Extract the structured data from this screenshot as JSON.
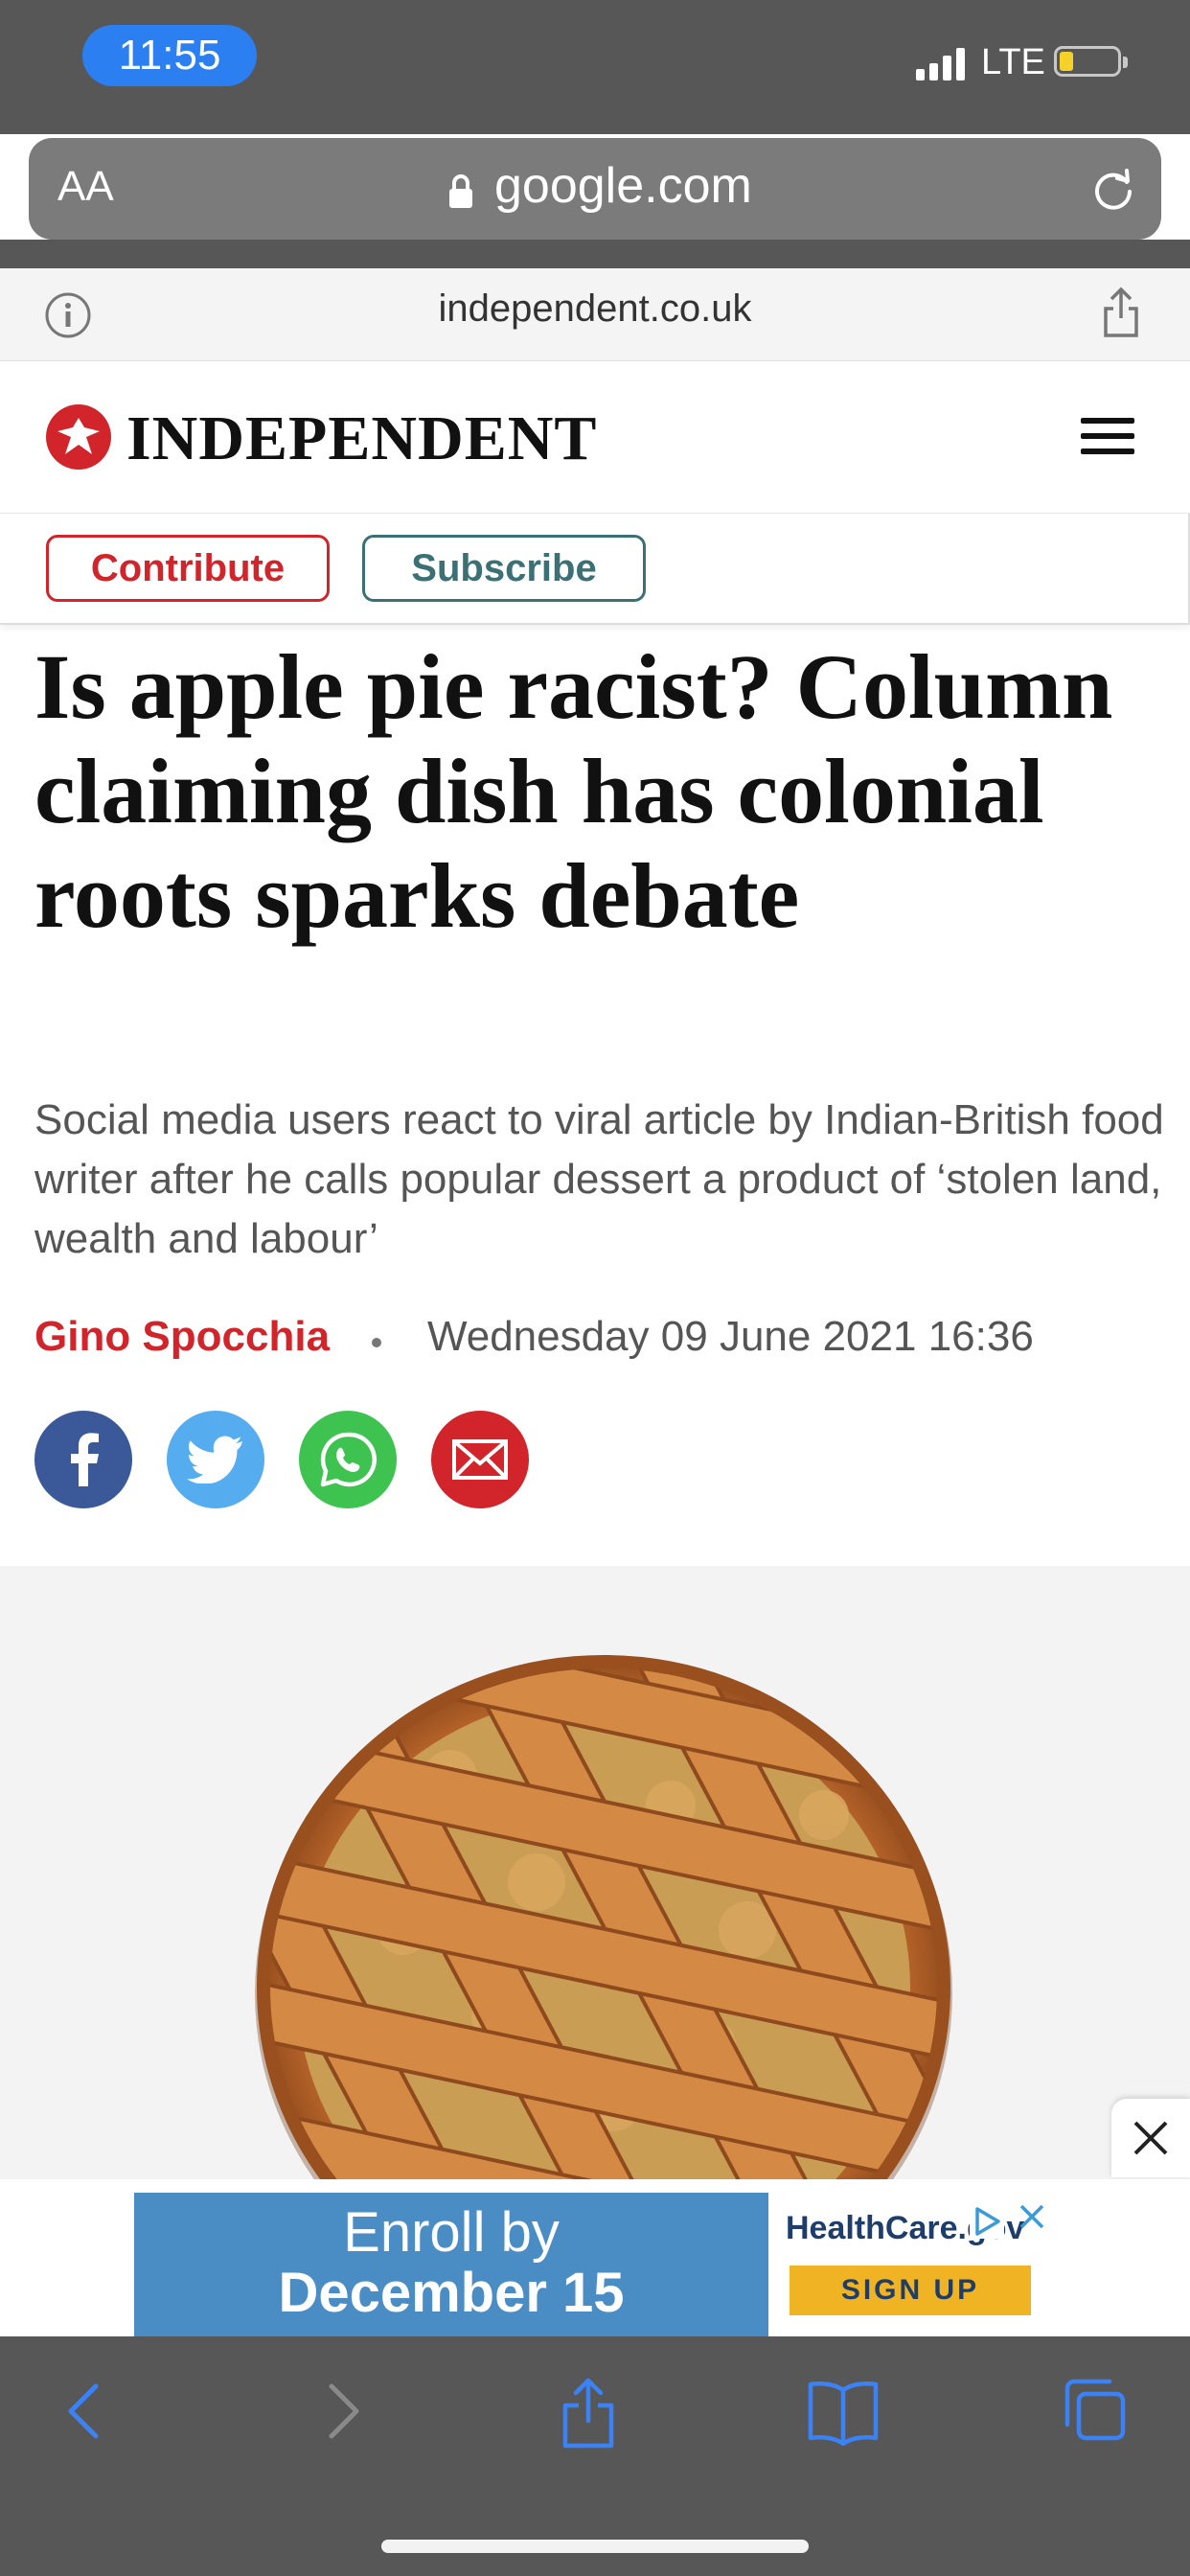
{
  "status_bar": {
    "time": "11:55",
    "network": "LTE",
    "battery_level": 0.2
  },
  "browser": {
    "text_size_label": "AA",
    "url": "google.com",
    "site_domain": "independent.co.uk"
  },
  "site": {
    "logo_text": "INDEPENDENT",
    "contribute_label": "Contribute",
    "subscribe_label": "Subscribe",
    "brand_color": "#d1242b"
  },
  "article": {
    "headline": "Is apple pie racist? Column claiming dish has colonial roots sparks debate",
    "standfirst": "Social media users react to viral article by Indian-British food writer after he calls popular dessert a product of ‘stolen land, wealth and labour’",
    "author": "Gino Spocchia",
    "date": "Wednesday 09 June 2021 16:36",
    "share_buttons": [
      "facebook-icon",
      "twitter-icon",
      "whatsapp-icon",
      "email-icon"
    ],
    "hero_image": "apple-pie-lattice"
  },
  "ad": {
    "line1": "Enroll by",
    "line2": "December 15",
    "brand": "HealthCare.gov",
    "cta": "SIGN UP"
  },
  "toolbar": {
    "items": [
      "back-icon",
      "forward-icon",
      "share-icon",
      "bookmarks-icon",
      "tabs-icon"
    ]
  }
}
